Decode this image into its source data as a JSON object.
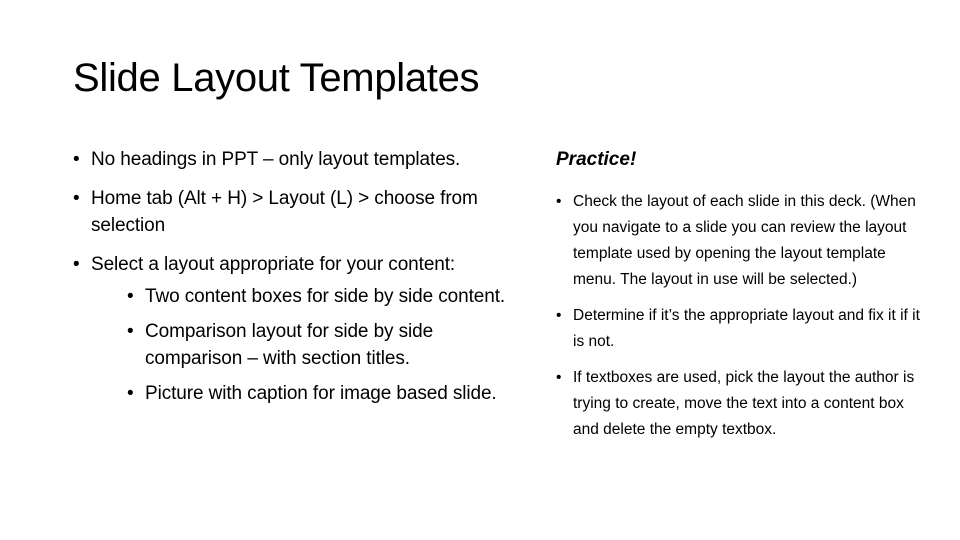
{
  "slide": {
    "title": "Slide Layout Templates",
    "left_column": {
      "bullets": [
        {
          "text": "No headings in PPT – only layout templates."
        },
        {
          "text": "Home tab (Alt + H) > Layout (L) > choose from selection"
        },
        {
          "text": "Select a layout appropriate for your content:",
          "sub_bullets": [
            "Two content boxes for side by side content.",
            "Comparison layout for side by side comparison – with section titles.",
            "Picture with caption for image based slide."
          ]
        }
      ]
    },
    "right_column": {
      "heading": "Practice!",
      "bullets": [
        "Check the layout of each slide in this deck. (When you navigate to a slide you can review the layout template used by opening the layout template menu. The layout in use will be selected.)",
        "Determine if it’s the appropriate layout and fix it if it is not.",
        "If textboxes are used, pick the layout the author is trying to create, move the text into a content box and delete the empty textbox."
      ]
    }
  }
}
